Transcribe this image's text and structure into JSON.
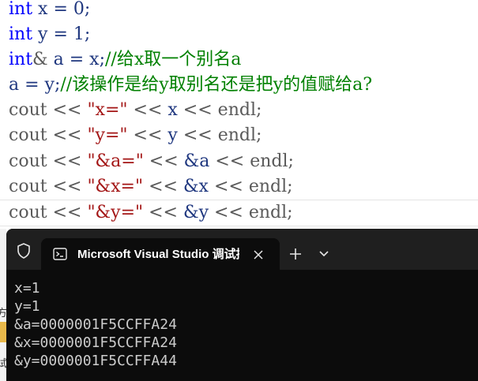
{
  "editor": {
    "lines": [
      {
        "type": "kw",
        "parts": [
          "int",
          " x = 0;"
        ]
      },
      {
        "type": "kw",
        "parts": [
          "int",
          " y = 1;"
        ]
      },
      {
        "type": "ref",
        "parts": [
          "int",
          "&",
          " a = x;",
          "//给x取一个别名a"
        ]
      },
      {
        "type": "assign",
        "parts": [
          "a = y;",
          "//该操作是给y取别名还是把y的值赋给a?"
        ]
      },
      {
        "type": "cout",
        "parts": [
          "cout",
          " << ",
          "\"x=\"",
          " << ",
          "x",
          " << ",
          "endl",
          ";"
        ]
      },
      {
        "type": "cout",
        "parts": [
          "cout",
          " << ",
          "\"y=\"",
          " << ",
          "y",
          " << ",
          "endl",
          ";"
        ]
      },
      {
        "type": "cout",
        "parts": [
          "cout",
          " << ",
          "\"&a=\"",
          " << ",
          "&a",
          " << ",
          "endl",
          ";"
        ]
      },
      {
        "type": "cout",
        "parts": [
          "cout",
          " << ",
          "\"&x=\"",
          " << ",
          "&x",
          " << ",
          "endl",
          ";"
        ]
      },
      {
        "type": "cout",
        "parts": [
          "cout",
          " << ",
          "\"&y=\"",
          " << ",
          "&y",
          " << ",
          "endl",
          ";"
        ]
      }
    ]
  },
  "terminal": {
    "tab_title": "Microsoft Visual Studio 调试控制台",
    "output": [
      "x=1",
      "y=1",
      "&a=0000001F5CCFFA24",
      "&x=0000001F5CCFFA24",
      "&y=0000001F5CCFFA44"
    ]
  },
  "background_window": {
    "fragments": [
      "方",
      "试"
    ]
  },
  "icons": {
    "shield": "shield-icon",
    "console": "console-icon",
    "close": "close-icon",
    "add": "plus-icon",
    "dropdown": "chevron-down-icon"
  },
  "colors": {
    "keyword": "#0000ff",
    "string": "#a31515",
    "comment": "#008000",
    "terminal_bg": "#0c0c0c",
    "titlebar_bg": "#1f1f1f"
  }
}
